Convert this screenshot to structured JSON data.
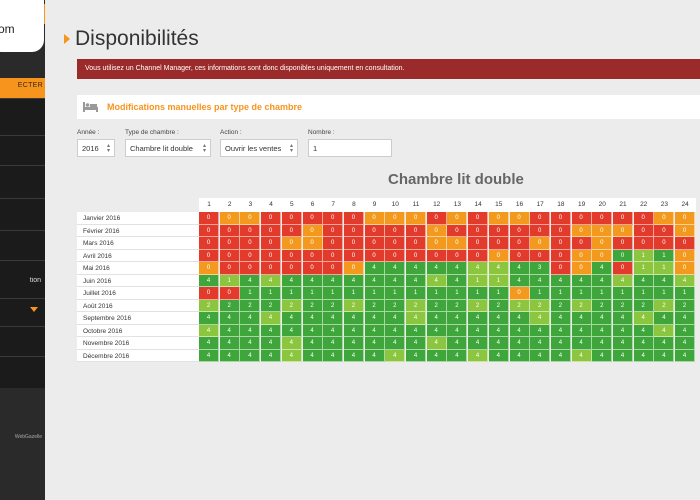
{
  "sidebar": {
    "logo_text": "om",
    "connect_label": "ECTER",
    "item_partial_label": "tion",
    "footer": "WebGazelle"
  },
  "page": {
    "title": "Disponibilités",
    "alert": "Vous utilisez un Channel Manager, ces informations sont donc disponibles uniquement en consultation.",
    "section_title": "Modifications manuelles par type de chambre"
  },
  "filters": {
    "annee_label": "Année :",
    "annee_value": "2016",
    "type_label": "Type de chambre :",
    "type_value": "Chambre lit double",
    "action_label": "Action :",
    "action_value": "Ouvrir les ventes",
    "nombre_label": "Nombre :",
    "nombre_value": "1"
  },
  "colors": {
    "accent": "#f7941d",
    "zero": "#e23a2b",
    "low": "#f39a1e",
    "mid": "#8cc63e",
    "high": "#3ea63a",
    "alert": "#9b2b2b"
  },
  "chart_data": {
    "type": "heatmap",
    "title": "Chambre lit double",
    "days": [
      "1",
      "2",
      "3",
      "4",
      "5",
      "6",
      "7",
      "8",
      "9",
      "10",
      "11",
      "12",
      "13",
      "14",
      "15",
      "16",
      "17",
      "18",
      "19",
      "20",
      "21",
      "22",
      "23",
      "24"
    ],
    "months": [
      "Janvier 2016",
      "Février 2016",
      "Mars 2016",
      "Avril 2016",
      "Mai 2016",
      "Juin 2016",
      "Juillet 2016",
      "Août 2016",
      "Septembre 2016",
      "Octobre 2016",
      "Novembre 2016",
      "Décembre 2016"
    ],
    "values": [
      [
        0,
        0,
        0,
        0,
        0,
        0,
        0,
        0,
        0,
        0,
        0,
        0,
        0,
        0,
        0,
        0,
        0,
        0,
        0,
        0,
        0,
        0,
        0,
        0
      ],
      [
        0,
        0,
        0,
        0,
        0,
        0,
        0,
        0,
        0,
        0,
        0,
        0,
        0,
        0,
        0,
        0,
        0,
        0,
        0,
        0,
        0,
        0,
        0,
        0
      ],
      [
        0,
        0,
        0,
        0,
        0,
        0,
        0,
        0,
        0,
        0,
        0,
        0,
        0,
        0,
        0,
        0,
        0,
        0,
        0,
        0,
        0,
        0,
        0,
        0
      ],
      [
        0,
        0,
        0,
        0,
        0,
        0,
        0,
        0,
        0,
        0,
        0,
        0,
        0,
        0,
        0,
        0,
        0,
        0,
        0,
        0,
        0,
        1,
        1,
        0
      ],
      [
        0,
        0,
        0,
        0,
        0,
        0,
        0,
        0,
        4,
        4,
        4,
        4,
        4,
        4,
        4,
        4,
        3,
        0,
        0,
        4,
        0,
        1,
        1,
        0
      ],
      [
        4,
        1,
        4,
        4,
        4,
        4,
        4,
        4,
        4,
        4,
        4,
        4,
        4,
        1,
        1,
        4,
        4,
        4,
        4,
        4,
        4,
        4,
        4,
        4
      ],
      [
        0,
        0,
        1,
        1,
        1,
        1,
        1,
        1,
        1,
        1,
        1,
        1,
        1,
        1,
        1,
        0,
        1,
        1,
        1,
        1,
        1,
        1,
        1,
        1
      ],
      [
        2,
        2,
        2,
        2,
        2,
        2,
        2,
        2,
        2,
        2,
        2,
        2,
        2,
        2,
        2,
        2,
        2,
        2,
        2,
        2,
        2,
        2,
        2,
        2
      ],
      [
        4,
        4,
        4,
        4,
        4,
        4,
        4,
        4,
        4,
        4,
        4,
        4,
        4,
        4,
        4,
        4,
        4,
        4,
        4,
        4,
        4,
        4,
        4,
        4
      ],
      [
        4,
        4,
        4,
        4,
        4,
        4,
        4,
        4,
        4,
        4,
        4,
        4,
        4,
        4,
        4,
        4,
        4,
        4,
        4,
        4,
        4,
        4,
        4,
        4
      ],
      [
        4,
        4,
        4,
        4,
        4,
        4,
        4,
        4,
        4,
        4,
        4,
        4,
        4,
        4,
        4,
        4,
        4,
        4,
        4,
        4,
        4,
        4,
        4,
        4
      ],
      [
        4,
        4,
        4,
        4,
        4,
        4,
        4,
        4,
        4,
        4,
        4,
        4,
        4,
        4,
        4,
        4,
        4,
        4,
        4,
        4,
        4,
        4,
        4,
        4
      ]
    ],
    "cell_colors": [
      [
        "zero",
        "low",
        "low",
        "zero",
        "zero",
        "zero",
        "zero",
        "zero",
        "low",
        "low",
        "low",
        "zero",
        "low",
        "zero",
        "low",
        "low",
        "zero",
        "zero",
        "zero",
        "zero",
        "zero",
        "zero",
        "low",
        "low"
      ],
      [
        "zero",
        "zero",
        "zero",
        "zero",
        "zero",
        "low",
        "zero",
        "zero",
        "zero",
        "zero",
        "zero",
        "low",
        "zero",
        "zero",
        "zero",
        "zero",
        "zero",
        "zero",
        "low",
        "low",
        "low",
        "zero",
        "zero",
        "low"
      ],
      [
        "zero",
        "zero",
        "zero",
        "zero",
        "low",
        "low",
        "zero",
        "zero",
        "zero",
        "zero",
        "zero",
        "low",
        "low",
        "zero",
        "zero",
        "zero",
        "low",
        "zero",
        "zero",
        "low",
        "zero",
        "zero",
        "zero",
        "zero"
      ],
      [
        "zero",
        "zero",
        "zero",
        "zero",
        "zero",
        "zero",
        "zero",
        "zero",
        "zero",
        "zero",
        "zero",
        "zero",
        "zero",
        "zero",
        "low",
        "zero",
        "zero",
        "zero",
        "low",
        "low",
        "high",
        "mid",
        "high",
        "low"
      ],
      [
        "low",
        "zero",
        "zero",
        "zero",
        "zero",
        "zero",
        "zero",
        "low",
        "high",
        "high",
        "high",
        "high",
        "high",
        "mid",
        "mid",
        "high",
        "high",
        "zero",
        "low",
        "high",
        "zero",
        "mid",
        "mid",
        "low"
      ],
      [
        "high",
        "mid",
        "high",
        "mid",
        "high",
        "high",
        "high",
        "high",
        "high",
        "high",
        "high",
        "mid",
        "high",
        "mid",
        "mid",
        "high",
        "high",
        "high",
        "high",
        "high",
        "mid",
        "high",
        "high",
        "mid"
      ],
      [
        "zero",
        "zero",
        "high",
        "high",
        "high",
        "high",
        "high",
        "high",
        "high",
        "high",
        "high",
        "high",
        "high",
        "high",
        "high",
        "low",
        "high",
        "high",
        "high",
        "high",
        "high",
        "high",
        "high",
        "high"
      ],
      [
        "mid",
        "high",
        "high",
        "high",
        "mid",
        "high",
        "high",
        "mid",
        "high",
        "high",
        "mid",
        "high",
        "high",
        "mid",
        "high",
        "mid",
        "mid",
        "high",
        "mid",
        "high",
        "high",
        "high",
        "mid",
        "high"
      ],
      [
        "high",
        "high",
        "high",
        "mid",
        "high",
        "high",
        "high",
        "high",
        "high",
        "high",
        "mid",
        "high",
        "high",
        "high",
        "high",
        "high",
        "mid",
        "high",
        "high",
        "high",
        "high",
        "mid",
        "high",
        "high"
      ],
      [
        "mid",
        "high",
        "high",
        "high",
        "high",
        "high",
        "high",
        "high",
        "high",
        "high",
        "high",
        "high",
        "high",
        "high",
        "high",
        "high",
        "high",
        "high",
        "high",
        "high",
        "high",
        "high",
        "mid",
        "high"
      ],
      [
        "high",
        "high",
        "high",
        "high",
        "mid",
        "high",
        "high",
        "high",
        "high",
        "high",
        "high",
        "mid",
        "high",
        "high",
        "high",
        "high",
        "high",
        "high",
        "high",
        "high",
        "high",
        "high",
        "high",
        "high"
      ],
      [
        "high",
        "high",
        "high",
        "high",
        "mid",
        "high",
        "high",
        "high",
        "high",
        "mid",
        "high",
        "high",
        "high",
        "mid",
        "high",
        "high",
        "high",
        "high",
        "mid",
        "high",
        "high",
        "high",
        "high",
        "high"
      ]
    ]
  }
}
